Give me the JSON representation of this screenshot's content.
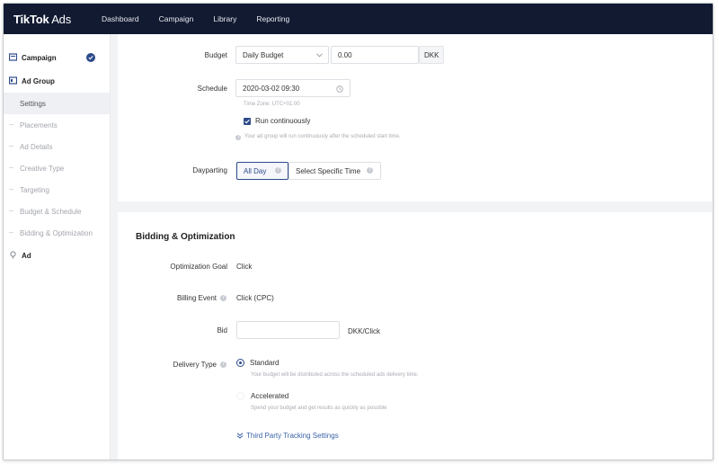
{
  "header": {
    "logo_main": "TikTok",
    "logo_sub": " Ads",
    "nav": [
      "Dashboard",
      "Campaign",
      "Library",
      "Reporting"
    ]
  },
  "sidebar": {
    "campaign": "Campaign",
    "ad_group": "Ad Group",
    "sub_items": [
      "Settings",
      "Placements",
      "Ad Details",
      "Creative Type",
      "Targeting",
      "Budget & Schedule",
      "Bidding & Optimization"
    ],
    "ad": "Ad"
  },
  "budget": {
    "label": "Budget",
    "type": "Daily Budget",
    "amount": "0.00",
    "currency": "DKK"
  },
  "schedule": {
    "label": "Schedule",
    "start": "2020-03-02 09:30",
    "timezone": "Time Zone: UTC+01:00",
    "run_continuously": "Run continuously",
    "note": "Your ad group will run continuously after the scheduled start time."
  },
  "dayparting": {
    "label": "Dayparting",
    "all_day": "All Day",
    "specific": "Select Specific Time"
  },
  "bidding": {
    "title": "Bidding & Optimization",
    "goal_label": "Optimization Goal",
    "goal_value": "Click",
    "billing_label": "Billing Event",
    "billing_value": "Click (CPC)",
    "bid_label": "Bid",
    "bid_value": "",
    "bid_unit": "DKK/Click",
    "delivery_label": "Delivery Type",
    "standard": "Standard",
    "standard_desc": "Your budget will be distributed across the scheduled ads delivery time.",
    "accelerated": "Accelerated",
    "accelerated_desc": "Spend your budget and get results as quickly as possible",
    "tracking": "Third Party Tracking Settings"
  },
  "colors": {
    "topbar": "#121a32",
    "accent": "#2d4a8a",
    "link": "#3a62a8"
  }
}
